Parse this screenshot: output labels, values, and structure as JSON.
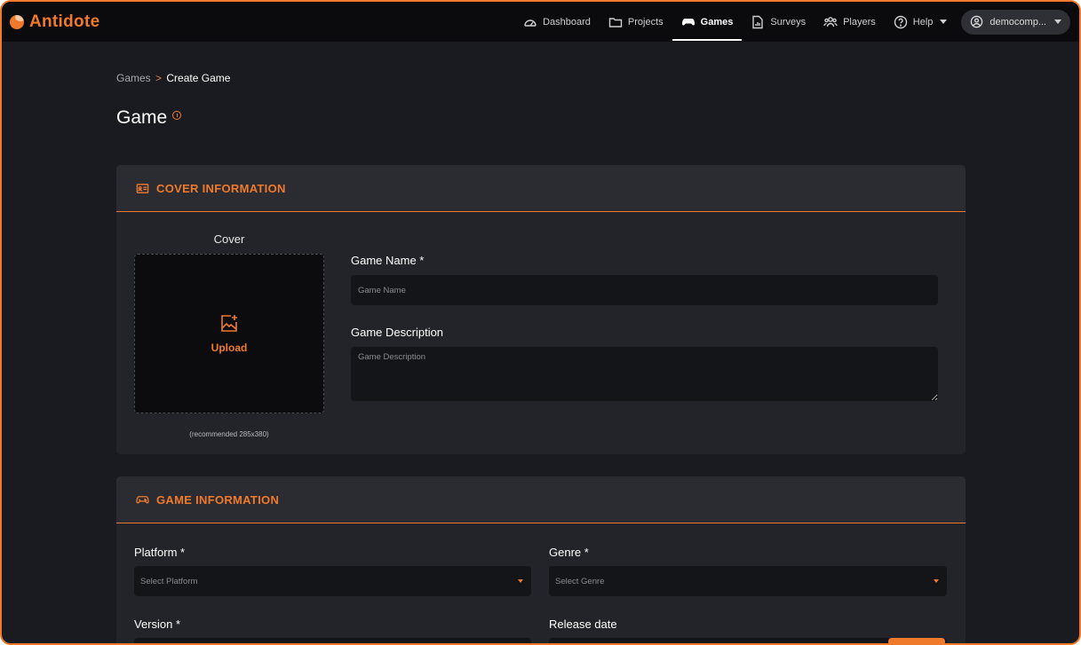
{
  "app": {
    "name": "Antidote"
  },
  "nav": {
    "items": [
      {
        "label": "Dashboard",
        "icon": "gauge-icon"
      },
      {
        "label": "Projects",
        "icon": "folder-icon"
      },
      {
        "label": "Games",
        "icon": "gamepad-icon",
        "active": true
      },
      {
        "label": "Surveys",
        "icon": "survey-icon"
      },
      {
        "label": "Players",
        "icon": "players-icon"
      },
      {
        "label": "Help",
        "icon": "help-icon"
      }
    ],
    "user": "democomp..."
  },
  "breadcrumb": {
    "parent": "Games",
    "separator": ">",
    "current": "Create Game"
  },
  "page": {
    "title": "Game"
  },
  "cover_section": {
    "title": "COVER INFORMATION",
    "cover_label": "Cover",
    "upload_label": "Upload",
    "recommendation": "(recommended 285x380)",
    "game_name_label": "Game Name *",
    "game_name_placeholder": "Game Name",
    "game_description_label": "Game Description",
    "game_description_placeholder": "Game Description"
  },
  "game_section": {
    "title": "GAME INFORMATION",
    "platform_label": "Platform *",
    "platform_placeholder": "Select Platform",
    "genre_label": "Genre *",
    "genre_placeholder": "Select Genre",
    "version_label": "Version *",
    "release_date_label": "Release date"
  },
  "colors": {
    "accent": "#f07a2c",
    "background": "#1a1b20",
    "card": "#23242a",
    "topbar": "#0b0b0d"
  }
}
